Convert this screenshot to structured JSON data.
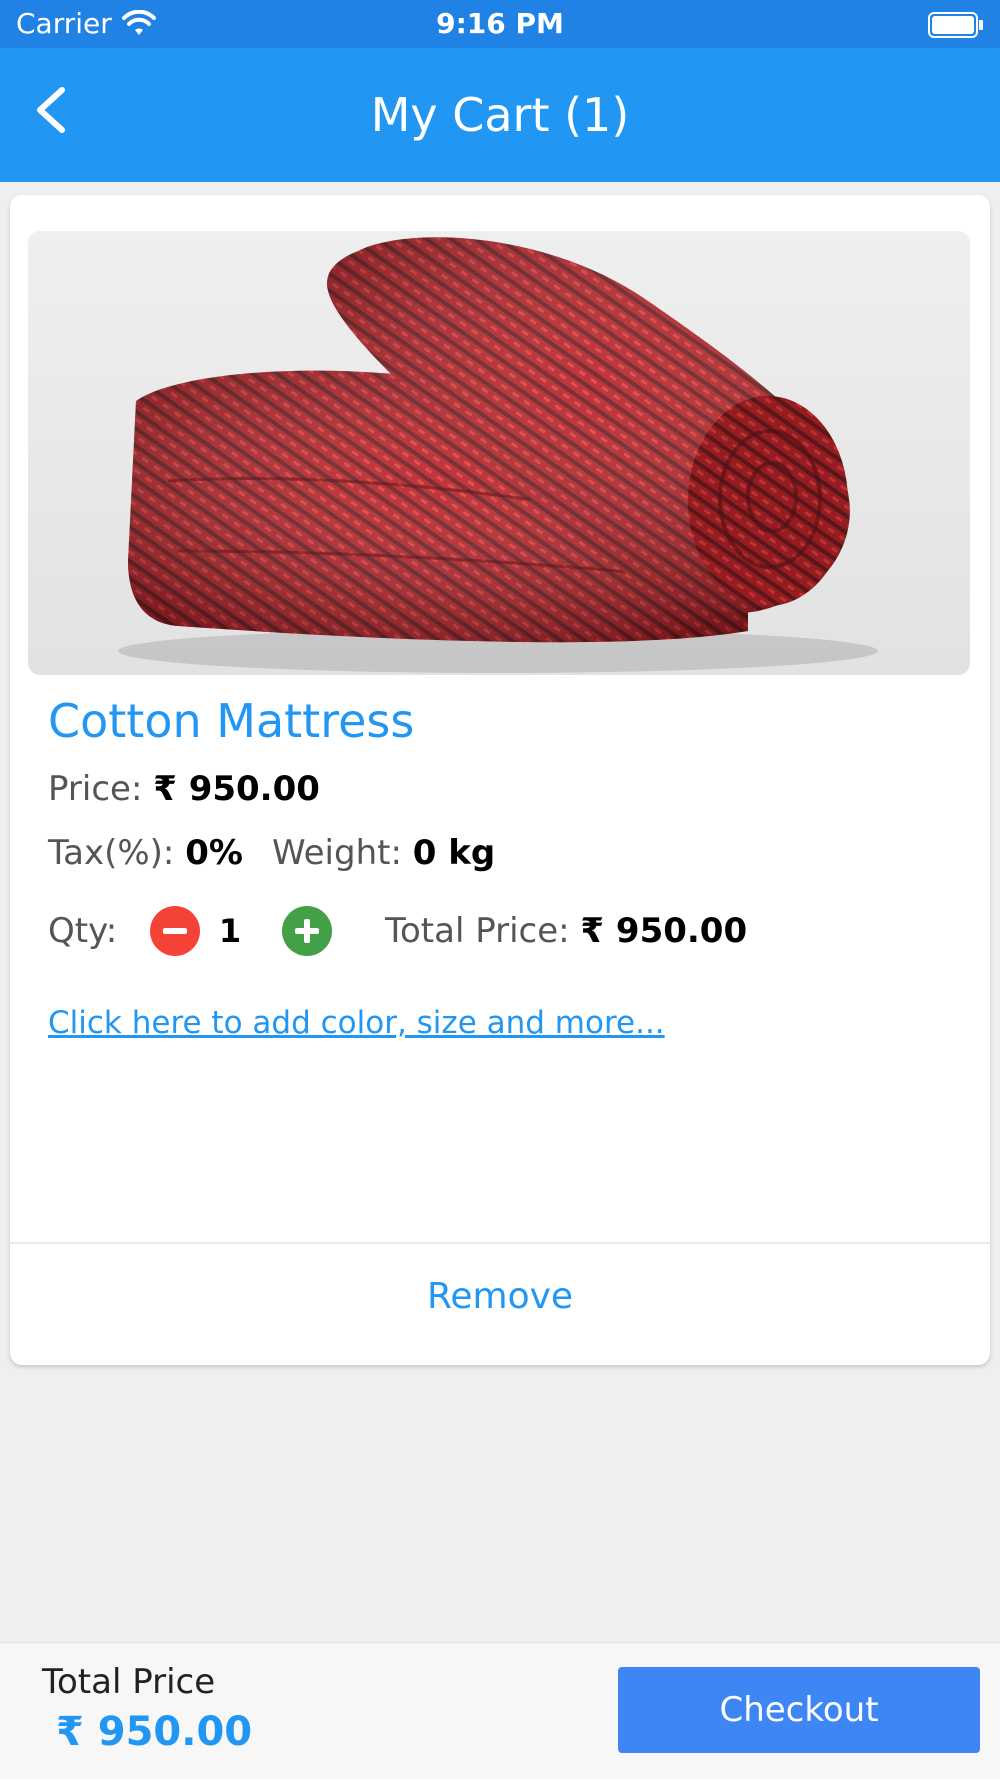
{
  "status_bar": {
    "carrier": "Carrier",
    "time": "9:16 PM"
  },
  "nav": {
    "title": "My Cart (1)"
  },
  "cart_item": {
    "name": "Cotton Mattress",
    "price_label": "Price:",
    "price_value": "₹ 950.00",
    "tax_label": "Tax(%):",
    "tax_value": "0%",
    "weight_label": "Weight:",
    "weight_value": "0 kg",
    "qty_label": "Qty:",
    "qty_value": "1",
    "total_label": "Total Price:",
    "total_value": "₹ 950.00",
    "options_link": "Click here to add color, size and more...",
    "remove_label": "Remove"
  },
  "bottom_bar": {
    "total_label": "Total Price",
    "total_value": "₹ 950.00",
    "checkout_label": "Checkout"
  },
  "colors": {
    "status_bar": "#1f82e4",
    "nav_bar": "#2196f3",
    "accent": "#2196f3",
    "minus_button": "#f44336",
    "plus_button": "#43a047",
    "checkout_button": "#3d86f4"
  },
  "icons": {
    "back": "chevron-left-icon",
    "wifi": "wifi-icon",
    "battery": "battery-icon",
    "minus": "minus-circle-icon",
    "plus": "plus-circle-icon"
  }
}
